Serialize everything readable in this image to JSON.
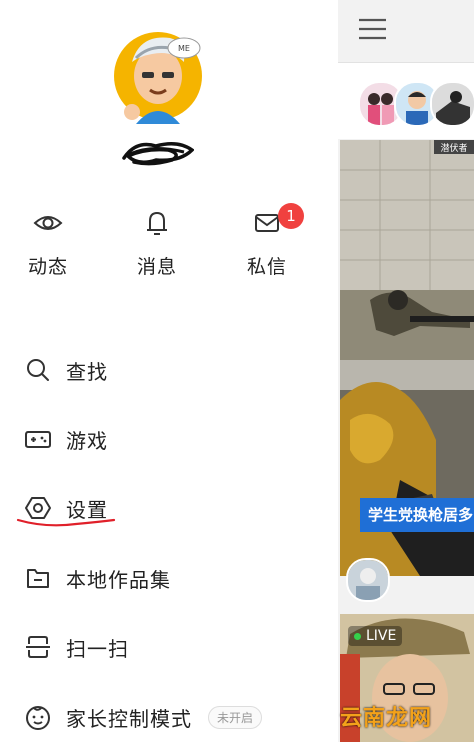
{
  "quick_actions": [
    {
      "label": "动态",
      "icon": "eye-icon"
    },
    {
      "label": "消息",
      "icon": "bell-icon"
    },
    {
      "label": "私信",
      "icon": "mail-icon",
      "badge": "1"
    }
  ],
  "menu": {
    "search": "查找",
    "games": "游戏",
    "settings": "设置",
    "local_works": "本地作品集",
    "scan": "扫一扫",
    "parental_mode": "家长控制模式",
    "parental_status": "未开启"
  },
  "avatar": {
    "tag": "ME"
  },
  "feed": {
    "game_hud": "潜伏者",
    "video_caption": "学生党换枪居多",
    "live_label": "LIVE"
  },
  "watermark": "云南龙网",
  "colors": {
    "badge": "#f0413f",
    "highlight_underline": "#e0202a",
    "caption_bg": "#1f6fd6"
  }
}
